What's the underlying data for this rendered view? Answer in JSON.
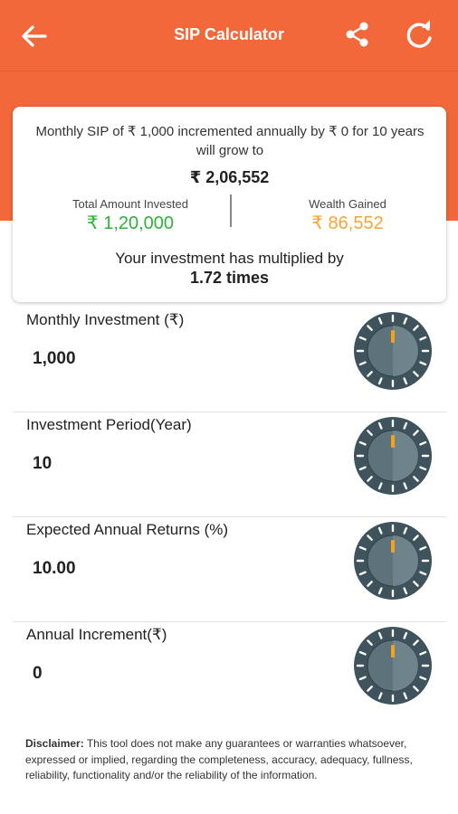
{
  "appbar": {
    "title": "SIP Calculator",
    "icons": [
      "back-arrow-icon",
      "share-icon",
      "refresh-icon"
    ],
    "background": "#f2683a"
  },
  "result": {
    "summary": "Monthly SIP of ₹ 1,000 incremented annually by ₹ 0 for 10 years will grow to",
    "total": "₹ 2,06,552",
    "invested_label": "Total Amount Invested",
    "invested_value": "₹ 1,20,000",
    "gained_label": "Wealth Gained",
    "gained_value": "₹ 86,552",
    "multiplier_text": "Your investment has multiplied by",
    "multiplier_value": "1.72 times",
    "colors": {
      "invested": "#2db33a",
      "gained": "#f4a63a"
    }
  },
  "inputs": [
    {
      "label": "Monthly Investment (₹)",
      "value": "1,000"
    },
    {
      "label": "Investment Period(Year)",
      "value": "10"
    },
    {
      "label": "Expected Annual Returns (%)",
      "value": "10.00"
    },
    {
      "label": "Annual Increment(₹)",
      "value": "0"
    }
  ],
  "disclaimer": {
    "title": "Disclaimer:",
    "text": " This tool does not make any guarantees or warranties whatsoever, expressed or implied, regarding the completeness, accuracy, adequacy, fullness, reliability, functionality and/or the reliability of the information."
  }
}
